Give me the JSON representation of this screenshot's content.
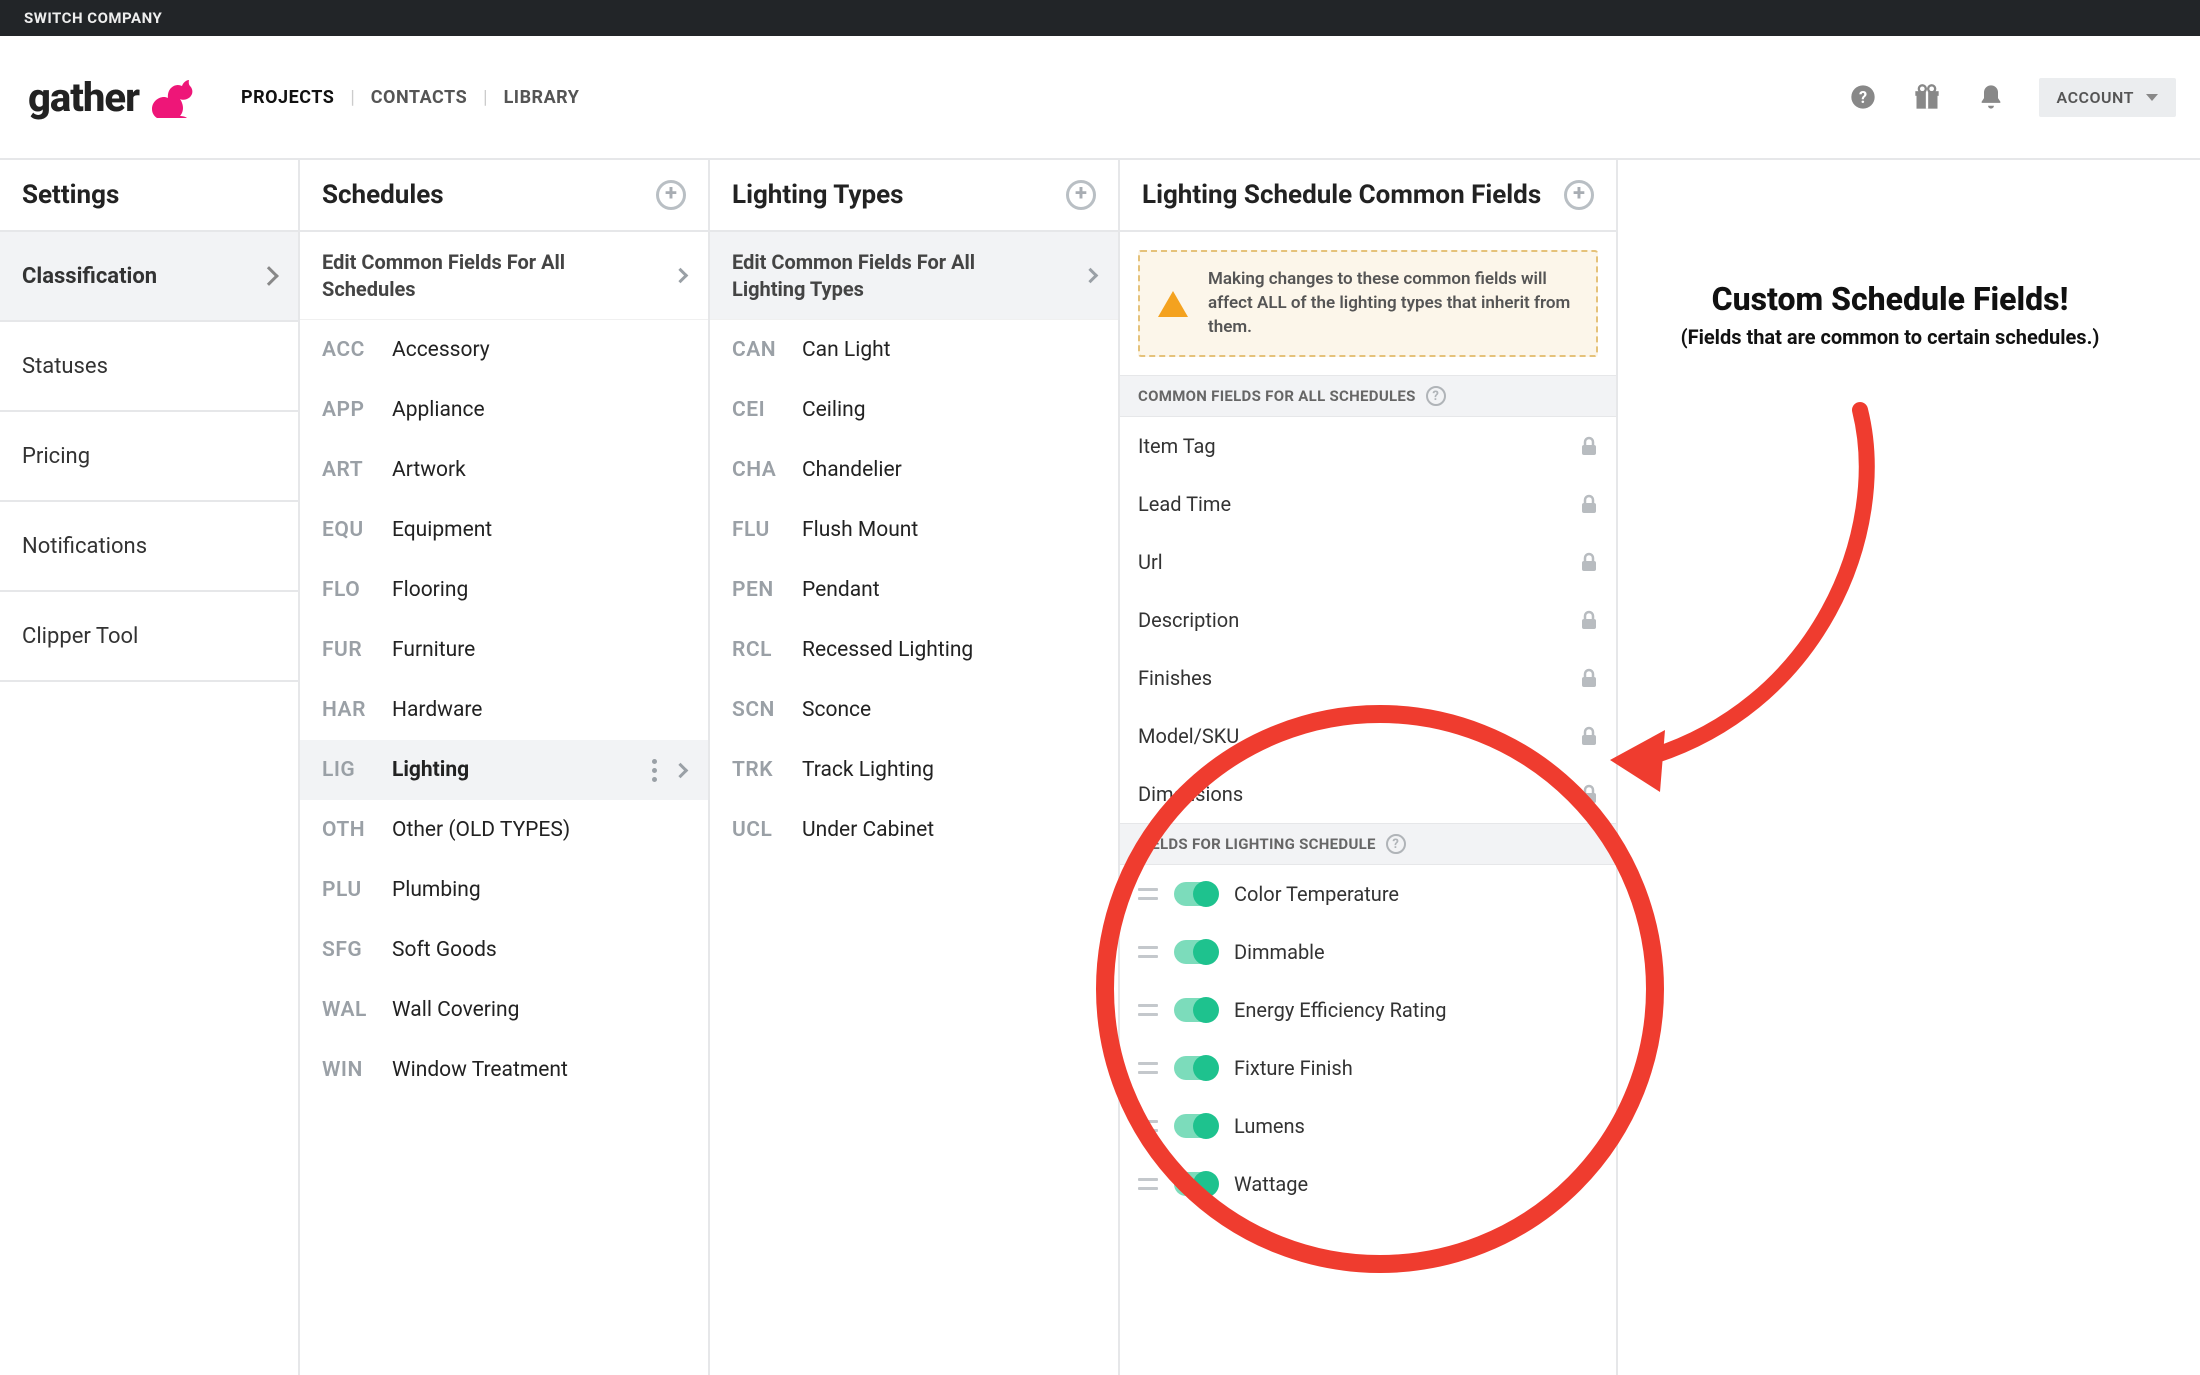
{
  "topbar": {
    "switch_company": "SWITCH COMPANY"
  },
  "header": {
    "logo_text": "gather",
    "nav": {
      "projects": "PROJECTS",
      "contacts": "CONTACTS",
      "library": "LIBRARY"
    },
    "account": "ACCOUNT"
  },
  "settings": {
    "title": "Settings",
    "items": [
      "Classification",
      "Statuses",
      "Pricing",
      "Notifications",
      "Clipper Tool"
    ]
  },
  "schedules": {
    "title": "Schedules",
    "edit_common": "Edit Common Fields For All Schedules",
    "rows": [
      {
        "code": "ACC",
        "label": "Accessory"
      },
      {
        "code": "APP",
        "label": "Appliance"
      },
      {
        "code": "ART",
        "label": "Artwork"
      },
      {
        "code": "EQU",
        "label": "Equipment"
      },
      {
        "code": "FLO",
        "label": "Flooring"
      },
      {
        "code": "FUR",
        "label": "Furniture"
      },
      {
        "code": "HAR",
        "label": "Hardware"
      },
      {
        "code": "LIG",
        "label": "Lighting"
      },
      {
        "code": "OTH",
        "label": "Other (OLD TYPES)"
      },
      {
        "code": "PLU",
        "label": "Plumbing"
      },
      {
        "code": "SFG",
        "label": "Soft Goods"
      },
      {
        "code": "WAL",
        "label": "Wall Covering"
      },
      {
        "code": "WIN",
        "label": "Window Treatment"
      }
    ]
  },
  "types": {
    "title": "Lighting Types",
    "edit_common": "Edit Common Fields For All Lighting Types",
    "rows": [
      {
        "code": "CAN",
        "label": "Can Light"
      },
      {
        "code": "CEI",
        "label": "Ceiling"
      },
      {
        "code": "CHA",
        "label": "Chandelier"
      },
      {
        "code": "FLU",
        "label": "Flush Mount"
      },
      {
        "code": "PEN",
        "label": "Pendant"
      },
      {
        "code": "RCL",
        "label": "Recessed Lighting"
      },
      {
        "code": "SCN",
        "label": "Sconce"
      },
      {
        "code": "TRK",
        "label": "Track Lighting"
      },
      {
        "code": "UCL",
        "label": "Under Cabinet"
      }
    ]
  },
  "fields": {
    "title": "Lighting Schedule Common Fields",
    "warning": "Making changes to these common fields will affect ALL of the lighting types that inherit from them.",
    "section_common": "COMMON FIELDS FOR ALL SCHEDULES",
    "common": [
      "Item Tag",
      "Lead Time",
      "Url",
      "Description",
      "Finishes",
      "Model/SKU",
      "Dimensions"
    ],
    "section_specific": "FIELDS FOR LIGHTING SCHEDULE",
    "specific": [
      "Color Temperature",
      "Dimmable",
      "Energy Efficiency Rating",
      "Fixture Finish",
      "Lumens",
      "Wattage"
    ]
  },
  "annotation": {
    "title": "Custom Schedule Fields!",
    "sub": "(Fields that are common to certain schedules.)"
  },
  "colors": {
    "accent_pink": "#ee1678",
    "toggle_on": "#1ec28e",
    "annotation_red": "#ef3c2f"
  }
}
